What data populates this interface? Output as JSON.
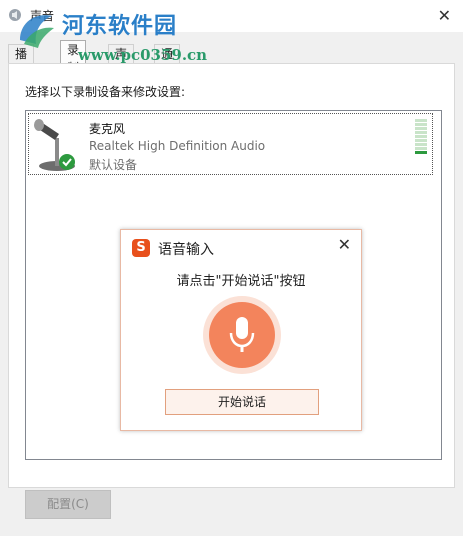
{
  "window": {
    "title": "声音",
    "close_glyph": "✕"
  },
  "watermark": {
    "line1": "河东软件园",
    "line2": "www.pc0359.cn"
  },
  "tabs": [
    {
      "label": "播放",
      "active": false
    },
    {
      "label": "录制",
      "active": true
    },
    {
      "label": "声音",
      "active": false
    },
    {
      "label": "通信",
      "active": false
    }
  ],
  "recording": {
    "instruction": "选择以下录制设备来修改设置:",
    "device": {
      "name": "麦克风",
      "driver": "Realtek High Definition Audio",
      "status": "默认设备",
      "icon": "microphone-icon",
      "default_badge_icon": "check-badge-icon"
    },
    "level_meter": {
      "bars_total": 9,
      "bars_lit": 1
    }
  },
  "buttons": {
    "configure": "配置(C)"
  },
  "voice_input": {
    "title": "语音输入",
    "logo_letter": "S",
    "close_glyph": "✕",
    "hint": "请点击\"开始说话\"按钮",
    "start_button": "开始说话",
    "accent_color": "#f3845c"
  }
}
